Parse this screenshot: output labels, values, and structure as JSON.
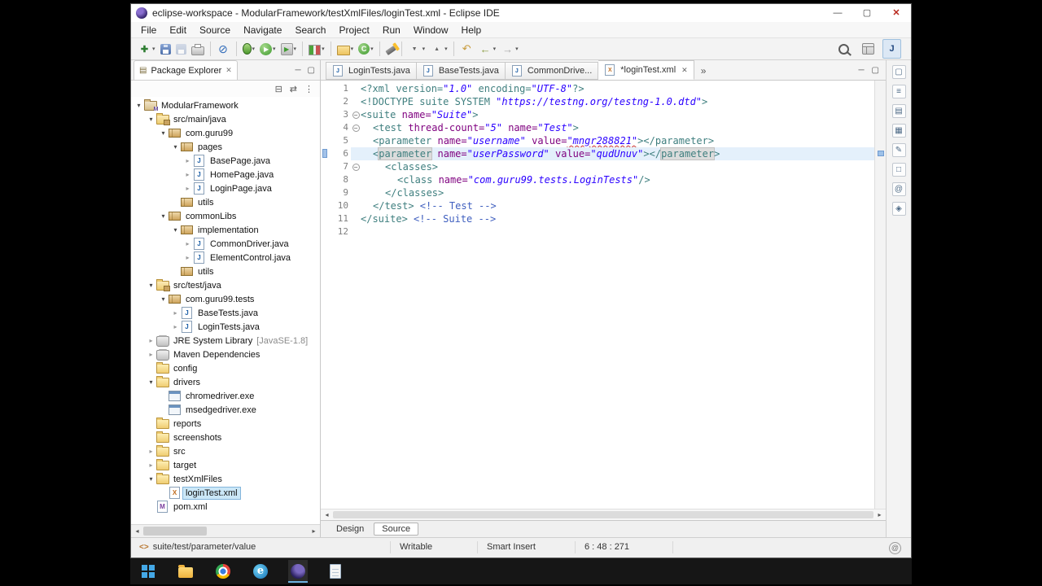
{
  "window": {
    "title": "eclipse-workspace - ModularFramework/testXmlFiles/loginTest.xml - Eclipse IDE",
    "controls": [
      {
        "name": "minimize-button",
        "glyph": "—"
      },
      {
        "name": "maximize-button",
        "glyph": "▢"
      },
      {
        "name": "close-button",
        "glyph": "✕"
      }
    ]
  },
  "glyphs": {
    "dropdown": "▾",
    "close": "✕",
    "minimize": "─",
    "maximize": "▢",
    "chevron_left": "◂",
    "chevron_right": "▸",
    "arrow_open": "▾",
    "arrow_closed": "▸",
    "fold_open": "−",
    "tag_icon": "<>",
    "notification": "@"
  },
  "menu_bar": {
    "items": [
      "File",
      "Edit",
      "Source",
      "Navigate",
      "Search",
      "Project",
      "Run",
      "Window",
      "Help"
    ]
  },
  "toolbar": {
    "groups": [
      [
        {
          "name": "new-wizard-button",
          "style": "new",
          "glyph": "✚",
          "dd": true
        },
        {
          "name": "save-button",
          "style": "save"
        },
        {
          "name": "save-all-button",
          "style": "saveall"
        },
        {
          "name": "print-button",
          "style": "print"
        }
      ],
      [
        {
          "name": "skip-breakpoints-button",
          "style": "skip",
          "glyph": "⊘"
        }
      ],
      [
        {
          "name": "debug-button",
          "style": "debug",
          "dd": true
        },
        {
          "name": "run-button",
          "style": "run",
          "glyph": "▶",
          "dd": true
        },
        {
          "name": "run-external-tools-button",
          "style": "ext",
          "glyph": "▶",
          "dd": true
        }
      ],
      [
        {
          "name": "coverage-button",
          "style": "cov",
          "dd": true
        }
      ],
      [
        {
          "name": "new-java-project-button",
          "style": "proj",
          "dd": true
        },
        {
          "name": "new-class-button",
          "style": "cls",
          "glyph": "C",
          "dd": true
        }
      ],
      [
        {
          "name": "open-search-button",
          "style": "flash"
        }
      ],
      [
        {
          "name": "next-annotation-button",
          "style": "ann",
          "glyph": "▼",
          "dd": true
        },
        {
          "name": "previous-annotation-button",
          "style": "ann",
          "glyph": "▲",
          "dd": true
        }
      ],
      [
        {
          "name": "last-edit-location-button",
          "style": "edit",
          "glyph": "↶"
        },
        {
          "name": "back-button",
          "style": "nav",
          "glyph": "←",
          "dd": true
        },
        {
          "name": "forward-button",
          "style": "navd",
          "glyph": "→",
          "dd": true
        }
      ]
    ],
    "right": [
      {
        "name": "quick-search-button",
        "style": "mag"
      },
      {
        "name": "open-perspective-button",
        "style": "persp"
      },
      {
        "name": "java-perspective-button",
        "style": "jpersp",
        "glyph": "J",
        "active": true
      }
    ]
  },
  "package_explorer": {
    "title": "Package Explorer",
    "tab_icon_glyph": "▤",
    "toolbar": [
      {
        "name": "collapse-all-button",
        "glyph": "⊟"
      },
      {
        "name": "link-with-editor-button",
        "glyph": "⇄"
      },
      {
        "name": "view-menu-button",
        "glyph": "⋮"
      }
    ],
    "tree": [
      {
        "label": "ModularFramework",
        "level": 0,
        "icon": "project",
        "arrow": "open"
      },
      {
        "label": "src/main/java",
        "level": 1,
        "icon": "source-folder",
        "arrow": "open"
      },
      {
        "label": "com.guru99",
        "level": 2,
        "icon": "package",
        "arrow": "open"
      },
      {
        "label": "pages",
        "level": 3,
        "icon": "package",
        "arrow": "open"
      },
      {
        "label": "BasePage.java",
        "level": 4,
        "icon": "java-file",
        "arrow": "closed"
      },
      {
        "label": "HomePage.java",
        "level": 4,
        "icon": "java-file",
        "arrow": "closed"
      },
      {
        "label": "LoginPage.java",
        "level": 4,
        "icon": "java-file",
        "arrow": "closed"
      },
      {
        "label": "utils",
        "level": 3,
        "icon": "package",
        "arrow": "none"
      },
      {
        "label": "commonLibs",
        "level": 2,
        "icon": "package",
        "arrow": "open"
      },
      {
        "label": "implementation",
        "level": 3,
        "icon": "package",
        "arrow": "open"
      },
      {
        "label": "CommonDriver.java",
        "level": 4,
        "icon": "java-file",
        "arrow": "closed"
      },
      {
        "label": "ElementControl.java",
        "level": 4,
        "icon": "java-file",
        "arrow": "closed"
      },
      {
        "label": "utils",
        "level": 3,
        "icon": "package",
        "arrow": "none"
      },
      {
        "label": "src/test/java",
        "level": 1,
        "icon": "source-folder",
        "arrow": "open"
      },
      {
        "label": "com.guru99.tests",
        "level": 2,
        "icon": "package",
        "arrow": "open"
      },
      {
        "label": "BaseTests.java",
        "level": 3,
        "icon": "java-file",
        "arrow": "closed"
      },
      {
        "label": "LoginTests.java",
        "level": 3,
        "icon": "java-file",
        "arrow": "closed"
      },
      {
        "label": "JRE System Library",
        "suffix": "[JavaSE-1.8]",
        "level": 1,
        "icon": "library",
        "arrow": "closed"
      },
      {
        "label": "Maven Dependencies",
        "level": 1,
        "icon": "library",
        "arrow": "closed"
      },
      {
        "label": "config",
        "level": 1,
        "icon": "folder",
        "arrow": "none"
      },
      {
        "label": "drivers",
        "level": 1,
        "icon": "folder",
        "arrow": "open"
      },
      {
        "label": "chromedriver.exe",
        "level": 2,
        "icon": "exe-file",
        "arrow": "none"
      },
      {
        "label": "msedgedriver.exe",
        "level": 2,
        "icon": "exe-file",
        "arrow": "none"
      },
      {
        "label": "reports",
        "level": 1,
        "icon": "folder",
        "arrow": "none"
      },
      {
        "label": "screenshots",
        "level": 1,
        "icon": "folder",
        "arrow": "none"
      },
      {
        "label": "src",
        "level": 1,
        "icon": "folder",
        "arrow": "closed"
      },
      {
        "label": "target",
        "level": 1,
        "icon": "folder",
        "arrow": "closed"
      },
      {
        "label": "testXmlFiles",
        "level": 1,
        "icon": "folder",
        "arrow": "open"
      },
      {
        "label": "loginTest.xml",
        "level": 2,
        "icon": "xml-file",
        "arrow": "none",
        "selected": true
      },
      {
        "label": "pom.xml",
        "level": 1,
        "icon": "maven-file",
        "arrow": "none"
      }
    ]
  },
  "editor": {
    "tabs": [
      {
        "label": "LoginTests.java",
        "icon": "java-file",
        "active": false
      },
      {
        "label": "BaseTests.java",
        "icon": "java-file",
        "active": false
      },
      {
        "label": "CommonDrive...",
        "icon": "java-file",
        "active": false
      },
      {
        "label": "*loginTest.xml",
        "icon": "xml-file",
        "active": true
      }
    ],
    "tab_overflow": "»",
    "page_tabs": [
      {
        "label": "Design",
        "active": false
      },
      {
        "label": "Source",
        "active": true
      }
    ],
    "code": {
      "lines": [
        {
          "n": 1,
          "indent": 0,
          "seg": [
            {
              "t": "<?xml ",
              "c": "tag"
            },
            {
              "t": "version=",
              "c": "tag"
            },
            {
              "t": "\"1.0\" ",
              "c": "val"
            },
            {
              "t": "encoding=",
              "c": "tag"
            },
            {
              "t": "\"UTF-8\"",
              "c": "val"
            },
            {
              "t": "?>",
              "c": "tag"
            }
          ]
        },
        {
          "n": 2,
          "indent": 0,
          "seg": [
            {
              "t": "<!DOCTYPE suite SYSTEM ",
              "c": "tag"
            },
            {
              "t": "\"https://testng.org/testng-1.0.dtd\"",
              "c": "val"
            },
            {
              "t": ">",
              "c": "tag"
            }
          ]
        },
        {
          "n": 3,
          "indent": 0,
          "fold": true,
          "seg": [
            {
              "t": "<suite ",
              "c": "tag"
            },
            {
              "t": "name=",
              "c": "attr"
            },
            {
              "t": "\"Suite\"",
              "c": "val"
            },
            {
              "t": ">",
              "c": "tag"
            }
          ]
        },
        {
          "n": 4,
          "indent": 1,
          "fold": true,
          "seg": [
            {
              "t": "<test ",
              "c": "tag"
            },
            {
              "t": "thread-count=",
              "c": "attr"
            },
            {
              "t": "\"5\" ",
              "c": "val"
            },
            {
              "t": "name=",
              "c": "attr"
            },
            {
              "t": "\"Test\"",
              "c": "val"
            },
            {
              "t": ">",
              "c": "tag"
            }
          ]
        },
        {
          "n": 5,
          "indent": 1,
          "seg": [
            {
              "t": "<parameter ",
              "c": "tag"
            },
            {
              "t": "name=",
              "c": "attr"
            },
            {
              "t": "\"username\" ",
              "c": "val"
            },
            {
              "t": "value=",
              "c": "attr"
            },
            {
              "t": "\"mngr288821\"",
              "c": "val",
              "sp": true
            },
            {
              "t": "></",
              "c": "tag"
            },
            {
              "t": "parameter",
              "c": "tag"
            },
            {
              "t": ">",
              "c": "tag"
            }
          ]
        },
        {
          "n": 6,
          "indent": 1,
          "current": true,
          "marker": true,
          "seg": [
            {
              "t": "<",
              "c": "tag"
            },
            {
              "t": "parameter",
              "c": "tag",
              "hl": true
            },
            {
              "t": " ",
              "c": "txt"
            },
            {
              "t": "name=",
              "c": "attr"
            },
            {
              "t": "\"userPassword\" ",
              "c": "val"
            },
            {
              "t": "value=",
              "c": "attr"
            },
            {
              "t": "\"qudUnuv\"",
              "c": "val"
            },
            {
              "t": "></",
              "c": "tag"
            },
            {
              "t": "parameter",
              "c": "tag",
              "hl": true
            },
            {
              "t": ">",
              "c": "tag"
            }
          ]
        },
        {
          "n": 7,
          "indent": 2,
          "fold": true,
          "seg": [
            {
              "t": "<classes>",
              "c": "tag"
            }
          ]
        },
        {
          "n": 8,
          "indent": 3,
          "seg": [
            {
              "t": "<class ",
              "c": "tag"
            },
            {
              "t": "name=",
              "c": "attr"
            },
            {
              "t": "\"com.guru99.tests.LoginTests\"",
              "c": "val"
            },
            {
              "t": "/>",
              "c": "tag"
            }
          ]
        },
        {
          "n": 9,
          "indent": 2,
          "seg": [
            {
              "t": "</classes>",
              "c": "tag"
            }
          ]
        },
        {
          "n": 10,
          "indent": 1,
          "seg": [
            {
              "t": "</test> ",
              "c": "tag"
            },
            {
              "t": "<!-- Test -->",
              "c": "com"
            }
          ]
        },
        {
          "n": 11,
          "indent": 0,
          "seg": [
            {
              "t": "</suite> ",
              "c": "tag"
            },
            {
              "t": "<!-- Suite -->",
              "c": "com"
            }
          ]
        },
        {
          "n": 12,
          "indent": 0,
          "seg": []
        }
      ]
    }
  },
  "right_strip": [
    {
      "name": "minimized-view-icon-1",
      "glyph": "▢"
    },
    {
      "name": "minimized-view-icon-2",
      "glyph": "≡"
    },
    {
      "name": "minimized-view-icon-3",
      "glyph": "▤"
    },
    {
      "name": "minimized-view-icon-4",
      "glyph": "▦"
    },
    {
      "name": "minimized-view-icon-5",
      "glyph": "✎"
    },
    {
      "name": "minimized-view-icon-6",
      "glyph": "□"
    },
    {
      "name": "minimized-view-icon-7",
      "glyph": "@"
    },
    {
      "name": "minimized-view-icon-8",
      "glyph": "◈"
    }
  ],
  "status_bar": {
    "element_path": "suite/test/parameter/value",
    "writable": "Writable",
    "insert_mode": "Smart Insert",
    "cursor_position": "6 : 48 : 271"
  },
  "taskbar": [
    {
      "name": "start-button",
      "style": "start"
    },
    {
      "name": "file-explorer-button",
      "style": "folder"
    },
    {
      "name": "chrome-button",
      "style": "chrome"
    },
    {
      "name": "edge-button",
      "style": "edge",
      "glyph": "e"
    },
    {
      "name": "eclipse-button",
      "style": "eclipse",
      "active": true
    },
    {
      "name": "notepad-button",
      "style": "notepad"
    }
  ]
}
